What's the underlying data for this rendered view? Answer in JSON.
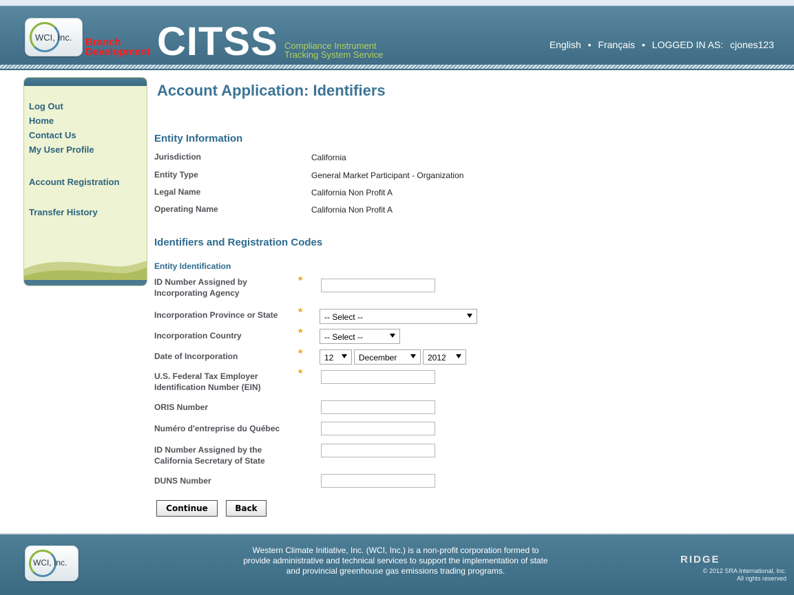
{
  "header": {
    "logo_text": "WCI, Inc.",
    "branch_label": "Branch Development",
    "app_name": "CITSS",
    "tagline_line1": "Compliance Instrument",
    "tagline_line2": "Tracking System Service",
    "nav": [
      "English",
      "Français",
      "LOGGED IN AS:"
    ],
    "username": "cjones123",
    "separator": "•"
  },
  "sidebar": {
    "items": [
      {
        "label": "Log Out"
      },
      {
        "label": "Home"
      },
      {
        "label": "Contact Us"
      },
      {
        "label": "My User Profile"
      },
      {
        "label": "Account Registration"
      },
      {
        "label": "Transfer History"
      }
    ]
  },
  "page": {
    "title": "Account Application: Identifiers"
  },
  "entity_info": {
    "heading": "Entity Information",
    "rows": [
      {
        "label": "Jurisdiction",
        "value": "California"
      },
      {
        "label": "Entity Type",
        "value": "General Market Participant - Organization"
      },
      {
        "label": "Legal Name",
        "value": "California Non Profit A"
      },
      {
        "label": "Operating Name",
        "value": "California Non Profit A"
      }
    ]
  },
  "identifiers": {
    "heading": "Identifiers and Registration Codes",
    "subheading": "Entity Identification",
    "required_marker": "*",
    "fields": [
      {
        "label": "ID Number Assigned by Incorporating Agency",
        "value": "",
        "required": true
      },
      {
        "label": "Incorporation Province or State",
        "value": "-- Select --",
        "required": true
      },
      {
        "label": "Incorporation Country",
        "value": "-- Select --",
        "required": true
      },
      {
        "label": "Date of Incorporation",
        "day": "12",
        "month": "December",
        "year": "2012",
        "required": true
      },
      {
        "label": "U.S. Federal Tax Employer Identification Number (EIN)",
        "value": "",
        "required": true
      },
      {
        "label": "ORIS Number",
        "value": ""
      },
      {
        "label": "Numéro d'entreprise du Québec",
        "value": ""
      },
      {
        "label": "ID Number Assigned by the California Secretary of State",
        "value": ""
      },
      {
        "label": "DUNS Number",
        "value": ""
      }
    ]
  },
  "buttons": {
    "continue": "Continue",
    "back": "Back"
  },
  "footer": {
    "logo_text": "WCI, Inc.",
    "description": "Western Climate Initiative, Inc. (WCI, Inc.) is a non-profit corporation formed to provide administrative and technical services to support the implementation of state and provincial greenhouse gas emissions trading programs.",
    "ridge_logo": "RIDGE",
    "copyright_line1": "© 2012 SRA International, Inc.",
    "copyright_line2": "All rights reserved"
  },
  "colors": {
    "header_blue": "#4a7a92",
    "title_blue": "#3c7494",
    "sidebar_bg": "#eef3d3",
    "required_orange": "#f39c12",
    "branch_red": "#ff1a1a"
  }
}
